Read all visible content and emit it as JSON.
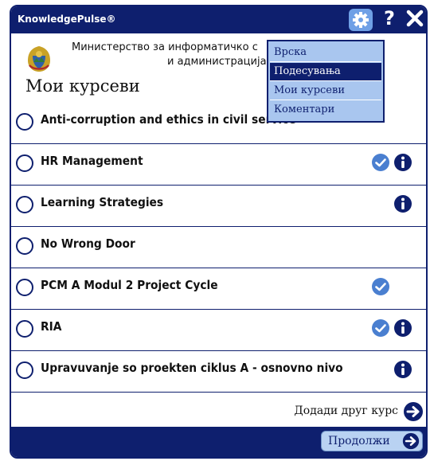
{
  "app": {
    "title": "KnowledgePulse®"
  },
  "titlebar": {
    "help_label": "?"
  },
  "organization": {
    "line1": "Министерство за информатичко с",
    "line2": "и администрација"
  },
  "page": {
    "title": "Мои курсеви"
  },
  "courses": [
    {
      "name": "Anti-corruption and ethics in civil service",
      "completed": false,
      "info": false
    },
    {
      "name": "HR Management",
      "completed": true,
      "info": true
    },
    {
      "name": "Learning Strategies",
      "completed": false,
      "info": true
    },
    {
      "name": "No Wrong Door",
      "completed": false,
      "info": false
    },
    {
      "name": "PCM A Modul 2 Project Cycle",
      "completed": true,
      "info": false
    },
    {
      "name": "RIA",
      "completed": true,
      "info": true
    },
    {
      "name": "Upravuvanje so proekten ciklus A - osnovno nivo",
      "completed": false,
      "info": true
    }
  ],
  "add_course": {
    "label": "Додади друг курс"
  },
  "footer": {
    "continue_label": "Продолжи"
  },
  "settings_menu": {
    "items": [
      {
        "label": "Врска",
        "active": false
      },
      {
        "label": "Подесувања",
        "active": true
      },
      {
        "label": "Мои курсеви",
        "active": false
      },
      {
        "label": "Коментари",
        "active": false
      }
    ]
  },
  "colors": {
    "primary": "#0e1f6e",
    "accent": "#a9c6ef",
    "check": "#4a7fd0"
  }
}
